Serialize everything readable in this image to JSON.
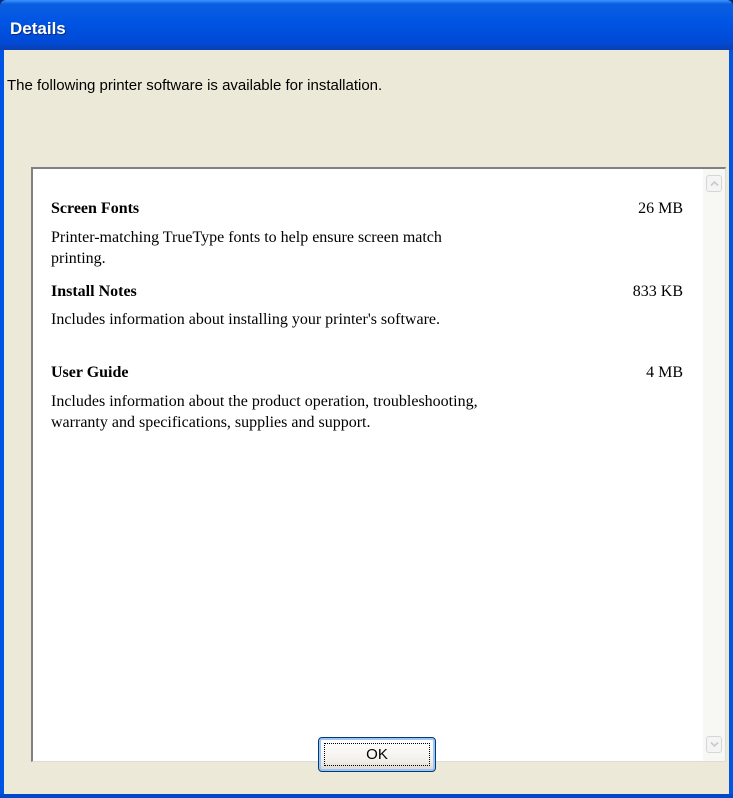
{
  "window": {
    "title": "Details"
  },
  "intro_text": "The following printer software is available for installation.",
  "items": [
    {
      "name": "Screen Fonts",
      "size": "26 MB",
      "description": "Printer-matching TrueType fonts to help ensure screen match printing."
    },
    {
      "name": "Install Notes",
      "size": "833 KB",
      "description": "Includes information about installing your printer's software."
    },
    {
      "name": "User Guide",
      "size": "4 MB",
      "description": "Includes information about the product operation, troubleshooting, warranty and specifications, supplies and support."
    }
  ],
  "buttons": {
    "ok_label": "OK"
  },
  "icons": {
    "scroll_up": "chevron-up-icon",
    "scroll_down": "chevron-down-icon"
  },
  "colors": {
    "titlebar": "#0054E3",
    "dialog_background": "#ECE9D8",
    "panel_background": "#FFFFFF"
  }
}
